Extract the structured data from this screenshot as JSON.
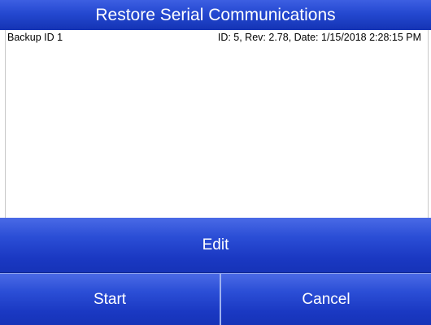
{
  "header": {
    "title": "Restore Serial Communications"
  },
  "backups": [
    {
      "name": "Backup ID 1",
      "details": "ID: 5, Rev: 2.78, Date: 1/15/2018 2:28:15 PM"
    }
  ],
  "buttons": {
    "edit": "Edit",
    "start": "Start",
    "cancel": "Cancel"
  },
  "colors": {
    "accent": "#2448d0",
    "background": "#ffffff"
  }
}
